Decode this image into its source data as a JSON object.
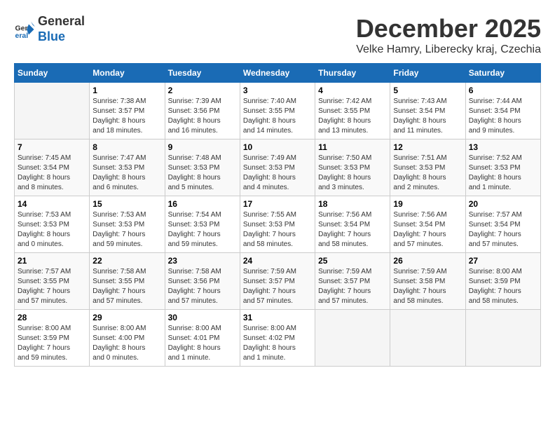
{
  "logo": {
    "general": "General",
    "blue": "Blue"
  },
  "title": {
    "month": "December 2025",
    "location": "Velke Hamry, Liberecky kraj, Czechia"
  },
  "days_of_week": [
    "Sunday",
    "Monday",
    "Tuesday",
    "Wednesday",
    "Thursday",
    "Friday",
    "Saturday"
  ],
  "weeks": [
    [
      {
        "day": "",
        "info": ""
      },
      {
        "day": "1",
        "info": "Sunrise: 7:38 AM\nSunset: 3:57 PM\nDaylight: 8 hours\nand 18 minutes."
      },
      {
        "day": "2",
        "info": "Sunrise: 7:39 AM\nSunset: 3:56 PM\nDaylight: 8 hours\nand 16 minutes."
      },
      {
        "day": "3",
        "info": "Sunrise: 7:40 AM\nSunset: 3:55 PM\nDaylight: 8 hours\nand 14 minutes."
      },
      {
        "day": "4",
        "info": "Sunrise: 7:42 AM\nSunset: 3:55 PM\nDaylight: 8 hours\nand 13 minutes."
      },
      {
        "day": "5",
        "info": "Sunrise: 7:43 AM\nSunset: 3:54 PM\nDaylight: 8 hours\nand 11 minutes."
      },
      {
        "day": "6",
        "info": "Sunrise: 7:44 AM\nSunset: 3:54 PM\nDaylight: 8 hours\nand 9 minutes."
      }
    ],
    [
      {
        "day": "7",
        "info": "Sunrise: 7:45 AM\nSunset: 3:54 PM\nDaylight: 8 hours\nand 8 minutes."
      },
      {
        "day": "8",
        "info": "Sunrise: 7:47 AM\nSunset: 3:53 PM\nDaylight: 8 hours\nand 6 minutes."
      },
      {
        "day": "9",
        "info": "Sunrise: 7:48 AM\nSunset: 3:53 PM\nDaylight: 8 hours\nand 5 minutes."
      },
      {
        "day": "10",
        "info": "Sunrise: 7:49 AM\nSunset: 3:53 PM\nDaylight: 8 hours\nand 4 minutes."
      },
      {
        "day": "11",
        "info": "Sunrise: 7:50 AM\nSunset: 3:53 PM\nDaylight: 8 hours\nand 3 minutes."
      },
      {
        "day": "12",
        "info": "Sunrise: 7:51 AM\nSunset: 3:53 PM\nDaylight: 8 hours\nand 2 minutes."
      },
      {
        "day": "13",
        "info": "Sunrise: 7:52 AM\nSunset: 3:53 PM\nDaylight: 8 hours\nand 1 minute."
      }
    ],
    [
      {
        "day": "14",
        "info": "Sunrise: 7:53 AM\nSunset: 3:53 PM\nDaylight: 8 hours\nand 0 minutes."
      },
      {
        "day": "15",
        "info": "Sunrise: 7:53 AM\nSunset: 3:53 PM\nDaylight: 7 hours\nand 59 minutes."
      },
      {
        "day": "16",
        "info": "Sunrise: 7:54 AM\nSunset: 3:53 PM\nDaylight: 7 hours\nand 59 minutes."
      },
      {
        "day": "17",
        "info": "Sunrise: 7:55 AM\nSunset: 3:53 PM\nDaylight: 7 hours\nand 58 minutes."
      },
      {
        "day": "18",
        "info": "Sunrise: 7:56 AM\nSunset: 3:54 PM\nDaylight: 7 hours\nand 58 minutes."
      },
      {
        "day": "19",
        "info": "Sunrise: 7:56 AM\nSunset: 3:54 PM\nDaylight: 7 hours\nand 57 minutes."
      },
      {
        "day": "20",
        "info": "Sunrise: 7:57 AM\nSunset: 3:54 PM\nDaylight: 7 hours\nand 57 minutes."
      }
    ],
    [
      {
        "day": "21",
        "info": "Sunrise: 7:57 AM\nSunset: 3:55 PM\nDaylight: 7 hours\nand 57 minutes."
      },
      {
        "day": "22",
        "info": "Sunrise: 7:58 AM\nSunset: 3:55 PM\nDaylight: 7 hours\nand 57 minutes."
      },
      {
        "day": "23",
        "info": "Sunrise: 7:58 AM\nSunset: 3:56 PM\nDaylight: 7 hours\nand 57 minutes."
      },
      {
        "day": "24",
        "info": "Sunrise: 7:59 AM\nSunset: 3:57 PM\nDaylight: 7 hours\nand 57 minutes."
      },
      {
        "day": "25",
        "info": "Sunrise: 7:59 AM\nSunset: 3:57 PM\nDaylight: 7 hours\nand 57 minutes."
      },
      {
        "day": "26",
        "info": "Sunrise: 7:59 AM\nSunset: 3:58 PM\nDaylight: 7 hours\nand 58 minutes."
      },
      {
        "day": "27",
        "info": "Sunrise: 8:00 AM\nSunset: 3:59 PM\nDaylight: 7 hours\nand 58 minutes."
      }
    ],
    [
      {
        "day": "28",
        "info": "Sunrise: 8:00 AM\nSunset: 3:59 PM\nDaylight: 7 hours\nand 59 minutes."
      },
      {
        "day": "29",
        "info": "Sunrise: 8:00 AM\nSunset: 4:00 PM\nDaylight: 8 hours\nand 0 minutes."
      },
      {
        "day": "30",
        "info": "Sunrise: 8:00 AM\nSunset: 4:01 PM\nDaylight: 8 hours\nand 1 minute."
      },
      {
        "day": "31",
        "info": "Sunrise: 8:00 AM\nSunset: 4:02 PM\nDaylight: 8 hours\nand 1 minute."
      },
      {
        "day": "",
        "info": ""
      },
      {
        "day": "",
        "info": ""
      },
      {
        "day": "",
        "info": ""
      }
    ]
  ]
}
